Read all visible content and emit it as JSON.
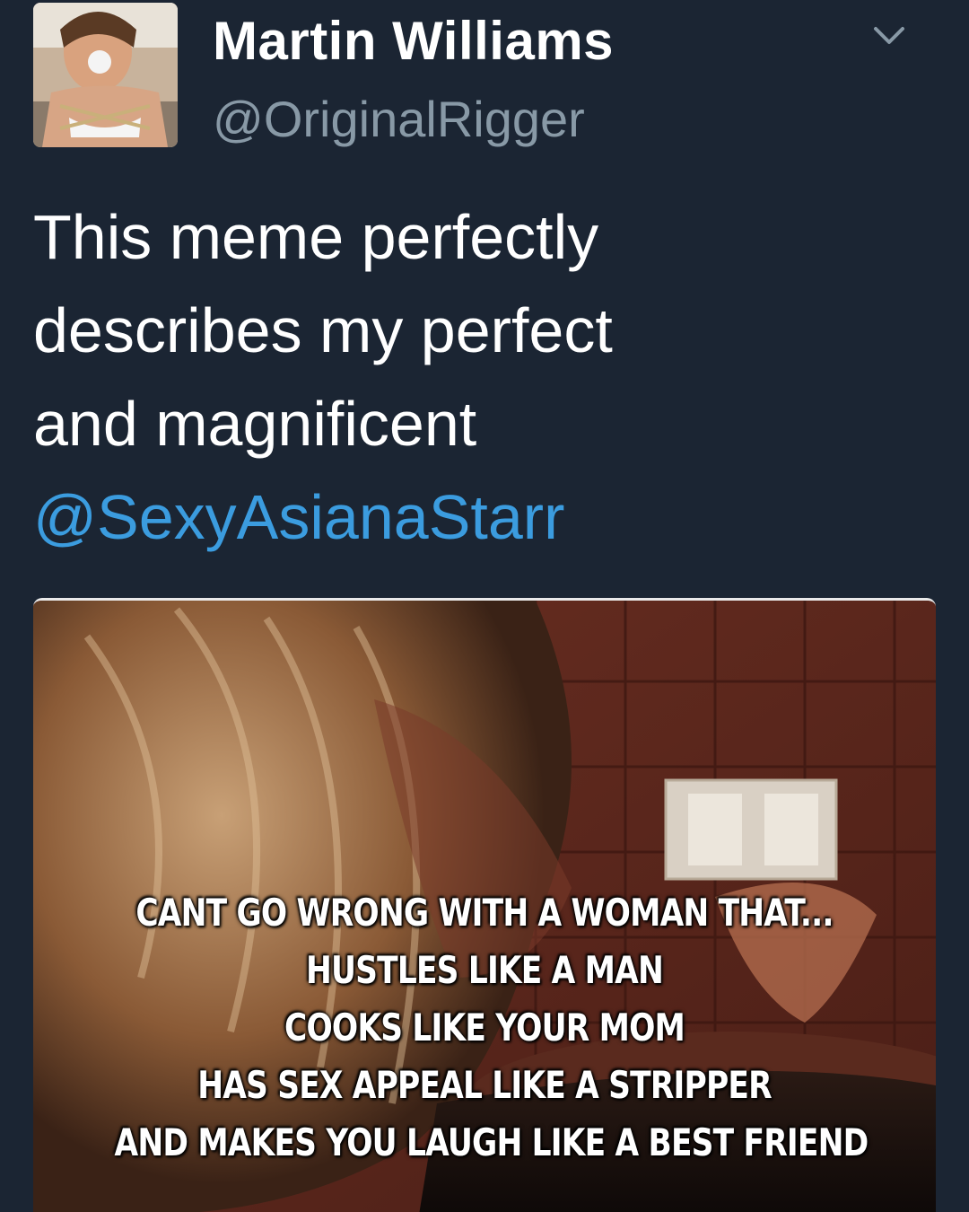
{
  "user": {
    "display_name": "Martin Williams",
    "handle": "@OriginalRigger",
    "avatar_icon": "profile-photo"
  },
  "menu": {
    "icon": "chevron-down-icon"
  },
  "tweet": {
    "lines": [
      "This meme perfectly",
      "describes my perfect",
      "and magnificent"
    ],
    "mention": "@SexyAsianaStarr"
  },
  "media": {
    "caption_lines": [
      "CANT GO WRONG WITH A WOMAN THAT...",
      "HUSTLES LIKE A MAN",
      "COOKS LIKE YOUR MOM",
      "HAS SEX APPEAL LIKE A STRIPPER",
      "AND MAKES YOU LAUGH LIKE A BEST FRIEND"
    ]
  },
  "colors": {
    "background": "#1b2533",
    "name": "#ffffff",
    "handle": "#8899a6",
    "mention": "#3b9cdf"
  }
}
